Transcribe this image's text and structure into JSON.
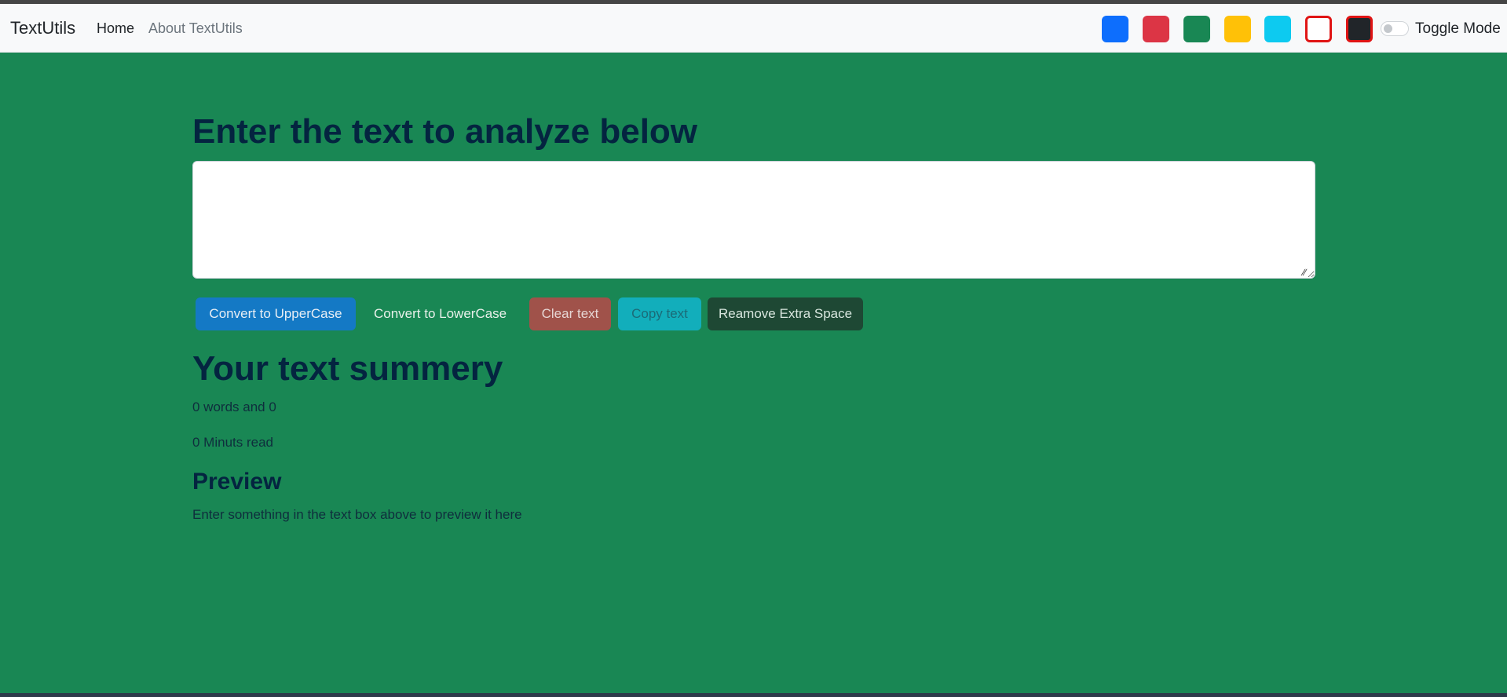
{
  "navbar": {
    "brand": "TextUtils",
    "links": [
      {
        "label": "Home"
      },
      {
        "label": "About TextUtils"
      }
    ],
    "color_swatches": [
      {
        "name": "primary",
        "color": "#0d6efd"
      },
      {
        "name": "danger",
        "color": "#dc3545"
      },
      {
        "name": "success",
        "color": "#198754"
      },
      {
        "name": "warning",
        "color": "#ffc107"
      },
      {
        "name": "info",
        "color": "#0dcaf0"
      },
      {
        "name": "light",
        "color": "#ffffff",
        "border": "#e01414"
      },
      {
        "name": "dark",
        "color": "#212529",
        "border": "#e01414"
      }
    ],
    "toggle_label": "Toggle Mode"
  },
  "main": {
    "heading": "Enter the text to analyze below",
    "textbox_value": "",
    "buttons": {
      "uppercase": "Convert to UpperCase",
      "lowercase": "Convert to LowerCase",
      "clear": "Clear text",
      "copy": "Copy text",
      "remove_space": "Reamove Extra Space"
    },
    "summary": {
      "heading": "Your text summery",
      "words_line": "0 words and 0",
      "read_line": "0 Minuts read"
    },
    "preview": {
      "heading": "Preview",
      "text": "Enter something in the text box above to preview it here"
    }
  },
  "theme": {
    "background": "#198754",
    "heading_color": "#042440"
  }
}
